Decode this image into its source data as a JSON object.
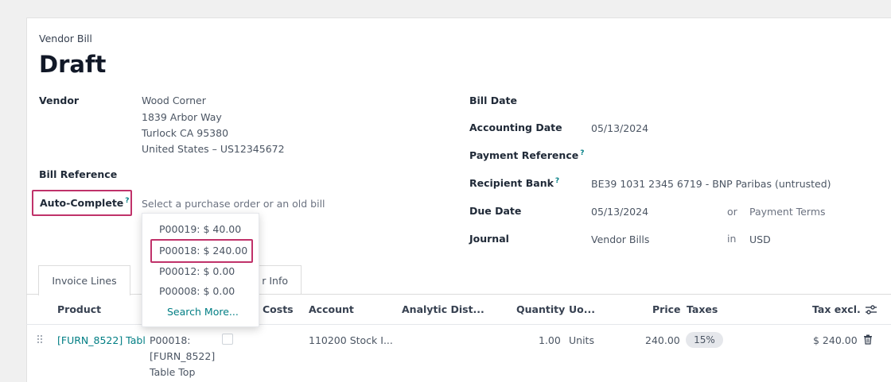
{
  "header": {
    "doc_type": "Vendor Bill",
    "status": "Draft"
  },
  "left_fields": {
    "vendor_label": "Vendor",
    "vendor_name": "Wood Corner",
    "vendor_address": [
      "1839 Arbor Way",
      "Turlock CA 95380",
      "United States – US12345672"
    ],
    "bill_reference_label": "Bill Reference",
    "auto_complete_label": "Auto-Complete",
    "auto_complete_help": "?",
    "auto_complete_placeholder": "Select a purchase order or an old bill"
  },
  "dropdown": {
    "items": [
      "P00019: $ 40.00",
      "P00018: $ 240.00",
      "P00012: $ 0.00",
      "P00008: $ 0.00"
    ],
    "search_more": "Search More..."
  },
  "right_fields": {
    "bill_date_label": "Bill Date",
    "accounting_date_label": "Accounting Date",
    "accounting_date_value": "05/13/2024",
    "payment_reference_label": "Payment Reference",
    "payment_reference_help": "?",
    "recipient_bank_label": "Recipient Bank",
    "recipient_bank_help": "?",
    "recipient_bank_value": "BE39 1031 2345 6719 - BNP Paribas (untrusted)",
    "due_date_label": "Due Date",
    "due_date_value": "05/13/2024",
    "due_or": "or",
    "payment_terms_placeholder": "Payment Terms",
    "journal_label": "Journal",
    "journal_value": "Vendor Bills",
    "journal_in": "in",
    "currency_value": "USD"
  },
  "tabs": {
    "invoice_lines": "Invoice Lines",
    "other_info_partial": "r Info"
  },
  "table": {
    "columns": {
      "product": "Product",
      "costs": "Costs",
      "account": "Account",
      "analytic": "Analytic Dist...",
      "quantity": "Quantity",
      "uom": "Uo...",
      "price": "Price",
      "taxes": "Taxes",
      "tax_excl": "Tax excl."
    },
    "row": {
      "product": "[FURN_8522] Tabl",
      "label_lines": [
        "P00018:",
        "[FURN_8522]",
        "Table Top"
      ],
      "account": "110200 Stock I...",
      "quantity": "1.00",
      "uom": "Units",
      "price": "240.00",
      "tax": "15%",
      "subtotal": "$ 240.00"
    }
  },
  "icons": {
    "drag": "drag-handle-icon",
    "columns": "column-settings-icon",
    "delete": "trash-icon"
  },
  "colors": {
    "highlight": "#c0326a",
    "link": "#017e84"
  }
}
